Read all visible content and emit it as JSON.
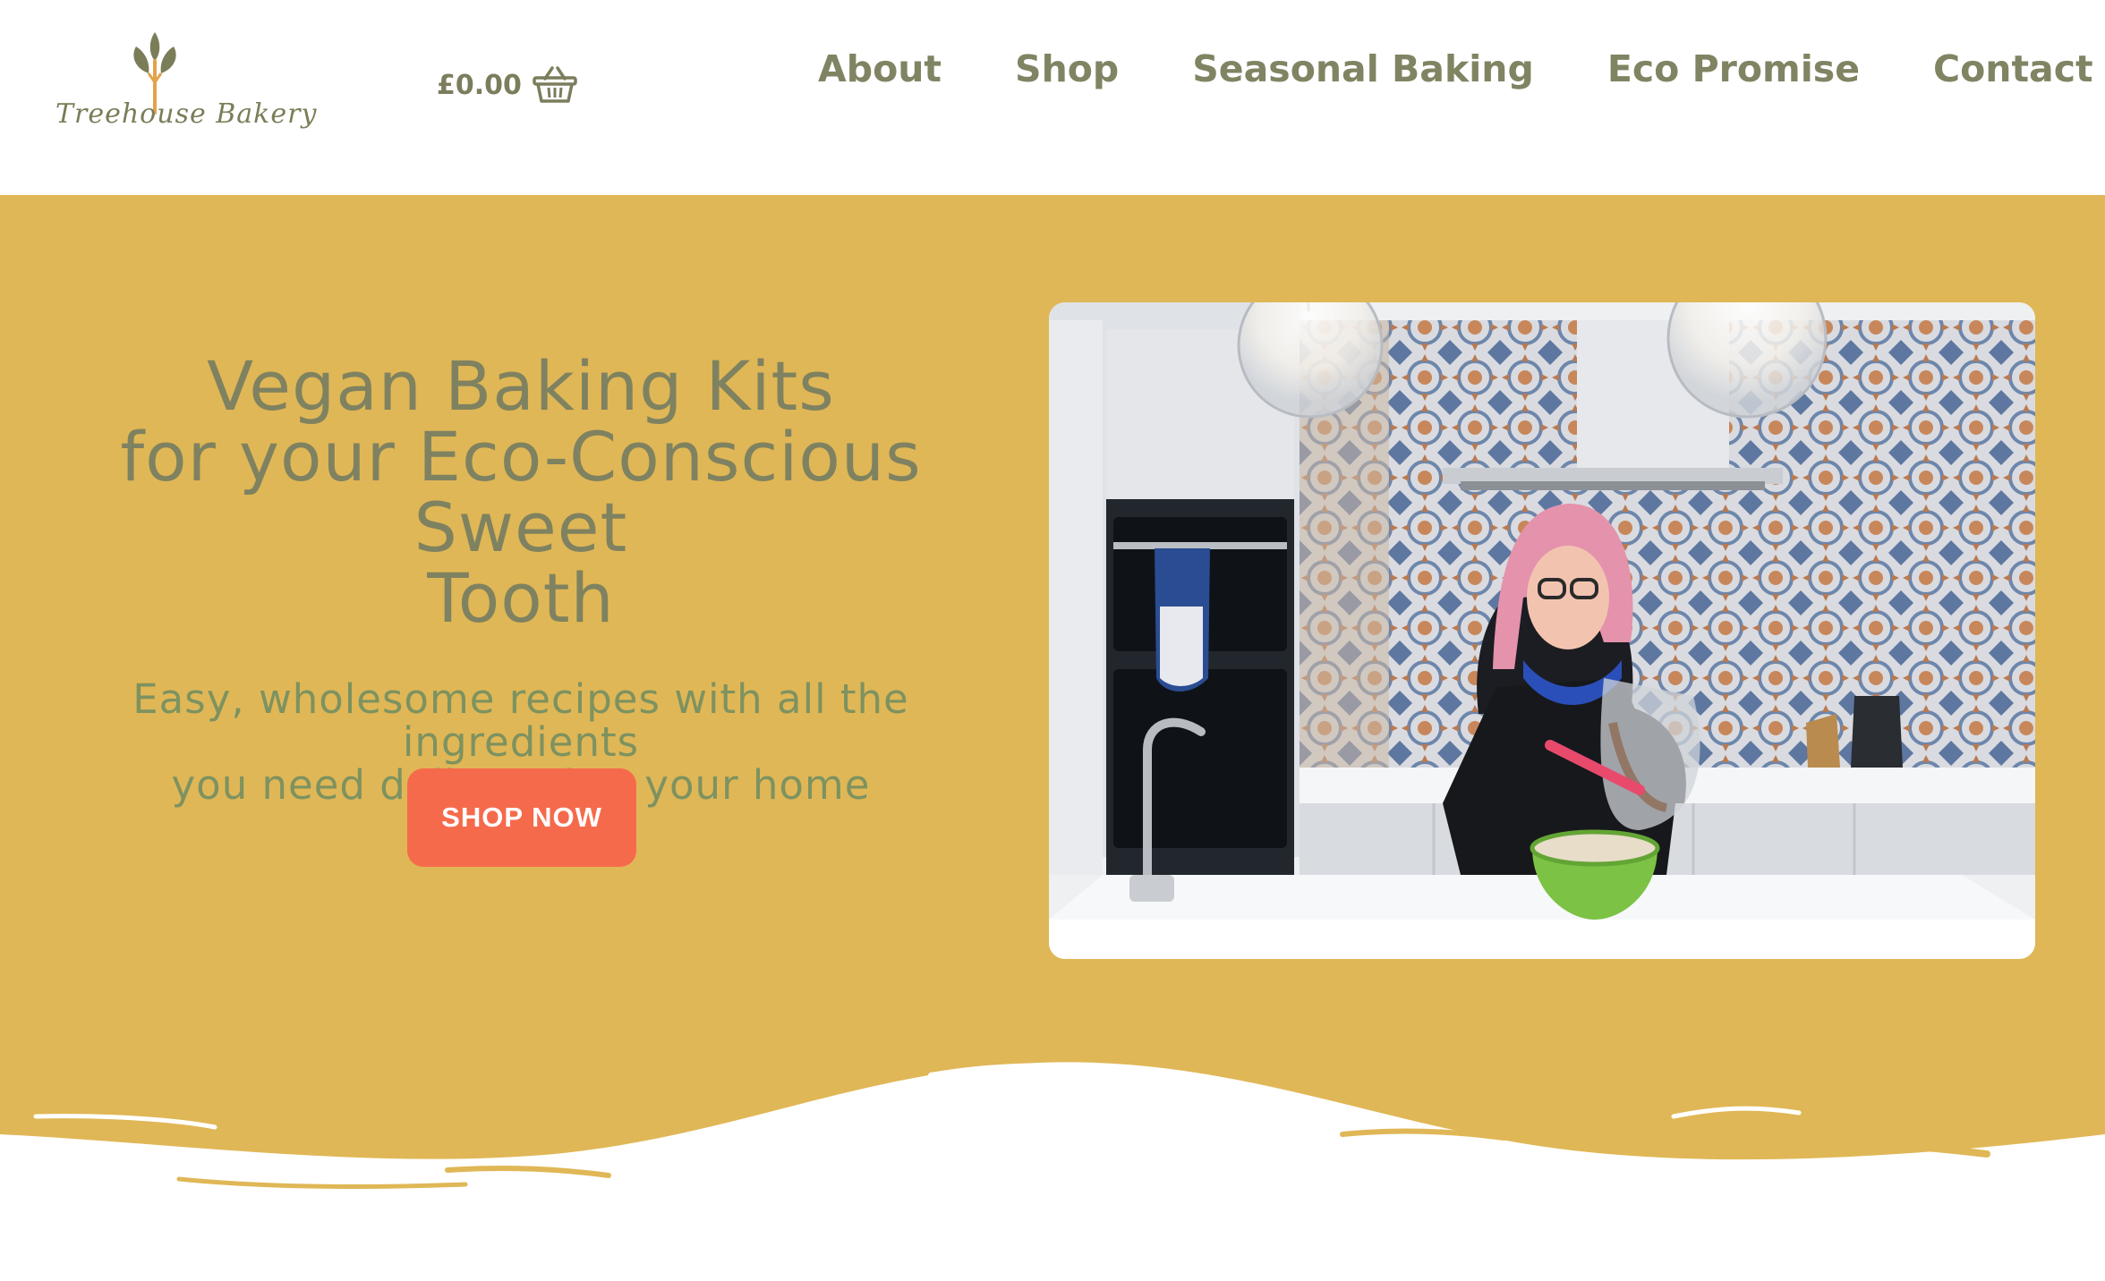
{
  "brand": {
    "name": "Treehouse Bakery",
    "colors": {
      "olive": "#818463",
      "mustard": "#e0b756",
      "coral": "#f66a4c",
      "sage": "#7d9260"
    }
  },
  "cart": {
    "total": "£0.00",
    "icon": "basket-icon"
  },
  "nav": {
    "items": [
      {
        "label": "About"
      },
      {
        "label": "Shop"
      },
      {
        "label": "Seasonal Baking"
      },
      {
        "label": "Eco Promise"
      },
      {
        "label": "Contact"
      }
    ]
  },
  "hero": {
    "title_line1": "Vegan Baking Kits",
    "title_line2": "for your Eco-Conscious Sweet",
    "title_line3": "Tooth",
    "subtitle_line1": "Easy, wholesome recipes with all the ingredients",
    "subtitle_line2": "you need delivered to your home",
    "cta_label": "SHOP NOW"
  }
}
